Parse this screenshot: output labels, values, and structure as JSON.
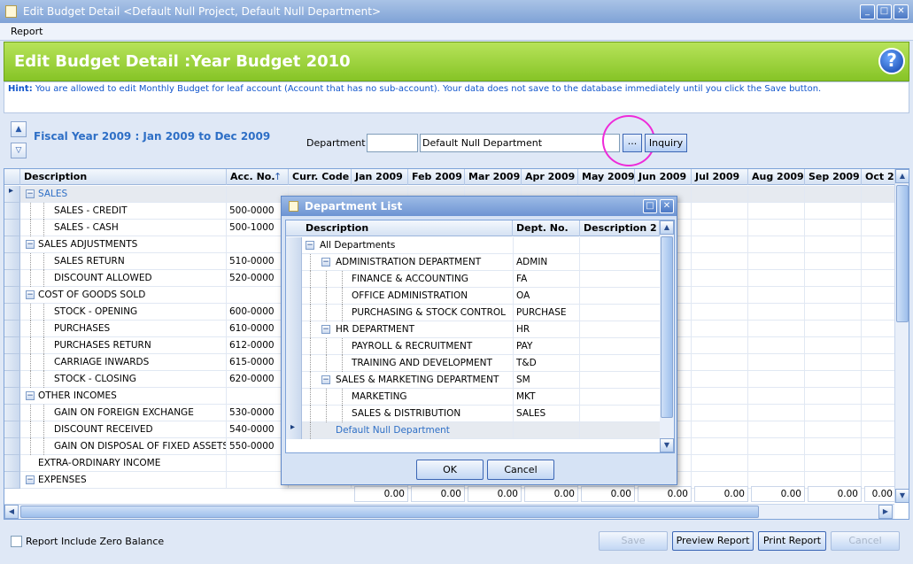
{
  "window": {
    "title": "Edit Budget Detail <Default Null Project, Default Null Department>"
  },
  "menu": {
    "report": "Report"
  },
  "header": {
    "title": "Edit Budget Detail  :Year  Budget 2010",
    "help": "?"
  },
  "hint": {
    "label": "Hint:",
    "text": "You are allowed to edit Monthly Budget for leaf account (Account that has no sub-account). Your data does not save to the database immediately until you click the Save button."
  },
  "fiscal": "Fiscal Year 2009 : Jan 2009 to Dec 2009",
  "department": {
    "label": "Department :",
    "code": "",
    "name": "Default Null Department",
    "lookup": "...",
    "inquiry": "Inquiry"
  },
  "grid": {
    "columns": [
      "Description",
      "Acc. No.",
      "Curr. Code",
      "Jan 2009",
      "Feb 2009",
      "Mar 2009",
      "Apr 2009",
      "May 2009",
      "Jun 2009",
      "Jul 2009",
      "Aug 2009",
      "Sep 2009",
      "Oct 2"
    ],
    "sort_indicator": "↑",
    "rows": [
      {
        "desc": "SALES",
        "acc": "",
        "level": 0,
        "group": true,
        "selected": true
      },
      {
        "desc": "SALES - CREDIT",
        "acc": "500-0000",
        "level": 1
      },
      {
        "desc": "SALES - CASH",
        "acc": "500-1000",
        "level": 1
      },
      {
        "desc": "SALES ADJUSTMENTS",
        "acc": "",
        "level": 0,
        "group": true
      },
      {
        "desc": "SALES RETURN",
        "acc": "510-0000",
        "level": 1
      },
      {
        "desc": "DISCOUNT ALLOWED",
        "acc": "520-0000",
        "level": 1
      },
      {
        "desc": "COST OF GOODS SOLD",
        "acc": "",
        "level": 0,
        "group": true
      },
      {
        "desc": "STOCK - OPENING",
        "acc": "600-0000",
        "level": 1
      },
      {
        "desc": "PURCHASES",
        "acc": "610-0000",
        "level": 1
      },
      {
        "desc": "PURCHASES RETURN",
        "acc": "612-0000",
        "level": 1
      },
      {
        "desc": "CARRIAGE INWARDS",
        "acc": "615-0000",
        "level": 1
      },
      {
        "desc": "STOCK - CLOSING",
        "acc": "620-0000",
        "level": 1
      },
      {
        "desc": "OTHER INCOMES",
        "acc": "",
        "level": 0,
        "group": true
      },
      {
        "desc": "GAIN ON FOREIGN EXCHANGE",
        "acc": "530-0000",
        "level": 1
      },
      {
        "desc": "DISCOUNT RECEIVED",
        "acc": "540-0000",
        "level": 1
      },
      {
        "desc": "GAIN ON DISPOSAL OF FIXED ASSETS",
        "acc": "550-0000",
        "level": 1
      },
      {
        "desc": "EXTRA-ORDINARY INCOME",
        "acc": "",
        "level": 0,
        "group": false
      },
      {
        "desc": "EXPENSES",
        "acc": "",
        "level": 0,
        "group": true
      }
    ],
    "totals": [
      "0.00",
      "0.00",
      "0.00",
      "0.00",
      "0.00",
      "0.00",
      "0.00",
      "0.00",
      "0.00",
      "0.00"
    ]
  },
  "dialog": {
    "title": "Department List",
    "columns": [
      "Description",
      "Dept. No.",
      "Description 2"
    ],
    "rows": [
      {
        "desc": "All Departments",
        "no": "",
        "level": 0,
        "group": true
      },
      {
        "desc": "ADMINISTRATION DEPARTMENT",
        "no": "ADMIN",
        "level": 1,
        "group": true
      },
      {
        "desc": "FINANCE & ACCOUNTING",
        "no": "FA",
        "level": 2
      },
      {
        "desc": "OFFICE ADMINISTRATION",
        "no": "OA",
        "level": 2
      },
      {
        "desc": "PURCHASING & STOCK CONTROL",
        "no": "PURCHASE",
        "level": 2
      },
      {
        "desc": "HR DEPARTMENT",
        "no": "HR",
        "level": 1,
        "group": true
      },
      {
        "desc": "PAYROLL & RECRUITMENT",
        "no": "PAY",
        "level": 2
      },
      {
        "desc": "TRAINING AND DEVELOPMENT",
        "no": "T&D",
        "level": 2
      },
      {
        "desc": "SALES & MARKETING DEPARTMENT",
        "no": "SM",
        "level": 1,
        "group": true
      },
      {
        "desc": "MARKETING",
        "no": "MKT",
        "level": 2
      },
      {
        "desc": "SALES & DISTRIBUTION",
        "no": "SALES",
        "level": 2
      },
      {
        "desc": "Default Null Department",
        "no": "",
        "level": 1,
        "selected": true
      }
    ],
    "ok": "OK",
    "cancel": "Cancel"
  },
  "bottom": {
    "zero_balance": "Report Include Zero Balance",
    "save": "Save",
    "preview": "Preview Report",
    "print": "Print Report",
    "cancel": "Cancel"
  },
  "colors": {
    "accent": "#86c426",
    "link": "#2e6fc6",
    "highlight": "#ee2ad9"
  }
}
